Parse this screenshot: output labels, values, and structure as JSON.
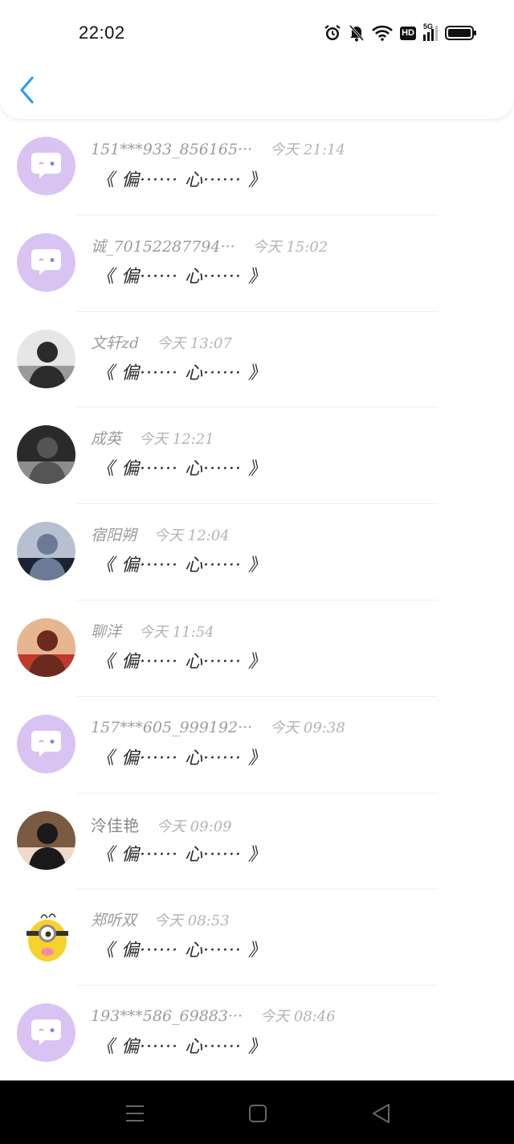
{
  "status_bar": {
    "time": "22:02",
    "icons": [
      "alarm-icon",
      "mute-bell-icon",
      "wifi-icon",
      "hd-icon",
      "5g-signal-icon",
      "battery-icon"
    ],
    "network_label": "5G",
    "hd_label": "HD"
  },
  "header": {
    "back_icon": "chevron-left-icon",
    "accent_color": "#2a9ff0"
  },
  "messages": [
    {
      "name": "151***933_856165···",
      "time": "今天 21:14",
      "text": "《 偏······ 心······ 》",
      "avatar": "default-chat-avatar"
    },
    {
      "name": "诚_70152287794···",
      "time": "今天 15:02",
      "text": "《 偏······ 心······ 》",
      "avatar": "default-chat-avatar"
    },
    {
      "name": "文轩zd",
      "time": "今天 13:07",
      "text": "《 偏······ 心······ 》",
      "avatar": "photo-avatar"
    },
    {
      "name": "成英",
      "time": "今天 12:21",
      "text": "《 偏······ 心······ 》",
      "avatar": "photo-avatar"
    },
    {
      "name": "宿阳朔",
      "time": "今天 12:04",
      "text": "《 偏······ 心······ 》",
      "avatar": "photo-avatar"
    },
    {
      "name": "聊洋",
      "time": "今天 11:54",
      "text": "《 偏······ 心······ 》",
      "avatar": "photo-avatar"
    },
    {
      "name": "157***605_999192···",
      "time": "今天 09:38",
      "text": "《 偏······ 心······ 》",
      "avatar": "default-chat-avatar"
    },
    {
      "name": "泠佳艳",
      "time": "今天 09:09",
      "text": "《 偏······ 心······ 》",
      "avatar": "photo-avatar"
    },
    {
      "name": "郑听双",
      "time": "今天 08:53",
      "text": "《 偏······ 心······ 》",
      "avatar": "minion-avatar"
    },
    {
      "name": "193***586_69883···",
      "time": "今天 08:46",
      "text": "《 偏······ 心······ 》",
      "avatar": "default-chat-avatar"
    }
  ],
  "nav_bar": {
    "buttons": [
      "menu-icon",
      "home-icon",
      "back-triangle-icon"
    ]
  },
  "colors": {
    "default_avatar_bg": "#d8c3f2",
    "nav_bar_bg": "#000000"
  }
}
